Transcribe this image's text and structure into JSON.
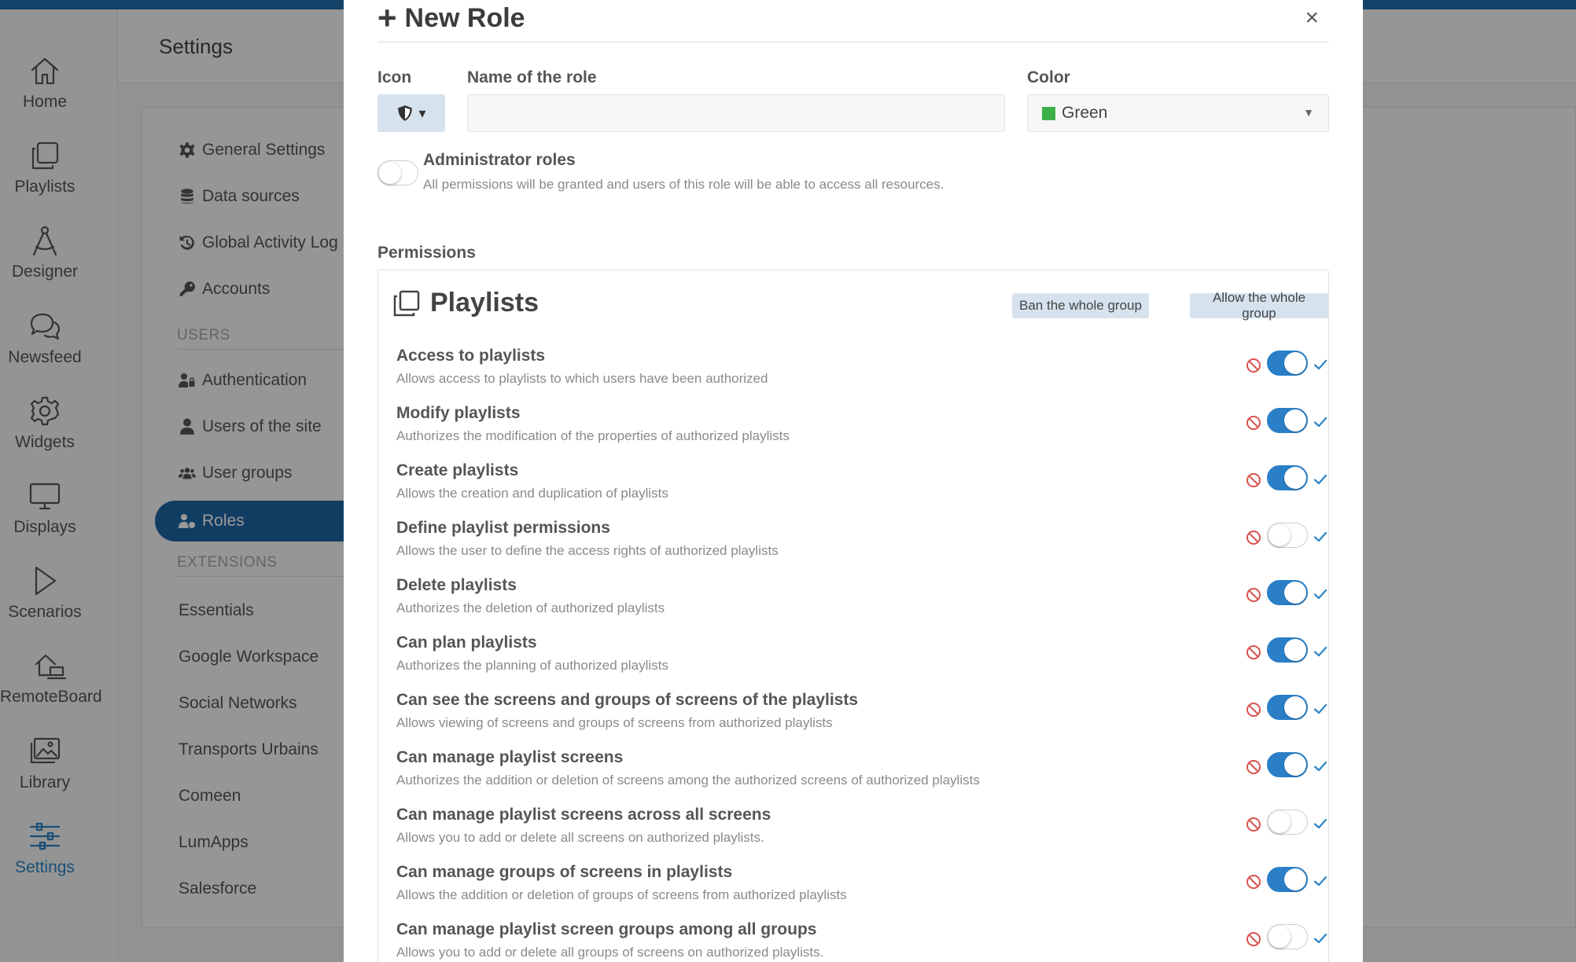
{
  "colors": {
    "primary": "#1f67a6",
    "toggle_on": "#2a7fc6",
    "ban": "#d9534f",
    "swatch_green": "#3db04a"
  },
  "rail": [
    {
      "label": "Home",
      "icon": "home-icon"
    },
    {
      "label": "Playlists",
      "icon": "playlists-icon"
    },
    {
      "label": "Designer",
      "icon": "designer-icon"
    },
    {
      "label": "Newsfeed",
      "icon": "newsfeed-icon"
    },
    {
      "label": "Widgets",
      "icon": "widgets-gear-icon"
    },
    {
      "label": "Displays",
      "icon": "displays-monitor-icon"
    },
    {
      "label": "Scenarios",
      "icon": "scenarios-play-icon"
    },
    {
      "label": "RemoteBoard",
      "icon": "remoteboard-icon"
    },
    {
      "label": "Library",
      "icon": "library-image-icon"
    },
    {
      "label": "Settings",
      "icon": "settings-sliders-icon",
      "active": true
    }
  ],
  "header": {
    "title": "Settings"
  },
  "settings_menu": {
    "items": [
      {
        "label": "General Settings",
        "icon": "gear-icon"
      },
      {
        "label": "Data sources",
        "icon": "database-icon"
      },
      {
        "label": "Global Activity Log",
        "icon": "history-icon"
      },
      {
        "label": "Accounts",
        "icon": "key-icon"
      }
    ],
    "users_section": "USERS",
    "user_items": [
      {
        "label": "Authentication",
        "icon": "user-lock-icon"
      },
      {
        "label": "Users of the site",
        "icon": "user-icon"
      },
      {
        "label": "User groups",
        "icon": "users-icon"
      },
      {
        "label": "Roles",
        "icon": "user-tag-icon",
        "active": true
      }
    ],
    "extensions_section": "EXTENSIONS",
    "extensions": [
      "Essentials",
      "Google Workspace",
      "Social Networks",
      "Transports Urbains",
      "Comeen",
      "LumApps",
      "Salesforce"
    ]
  },
  "modal": {
    "title": "New Role",
    "close": "×",
    "icon_label": "Icon",
    "name_label": "Name of the role",
    "name_value": "",
    "color_label": "Color",
    "color_value": "Green",
    "admin_title": "Administrator roles",
    "admin_desc": "All permissions will be granted and users of this role will be able to access all resources.",
    "admin_enabled": false,
    "permissions_label": "Permissions",
    "group": {
      "title": "Playlists",
      "ban_all": "Ban the whole group",
      "allow_all": "Allow the whole group",
      "permissions": [
        {
          "name": "Access to playlists",
          "desc": "Allows access to playlists to which users have been authorized",
          "enabled": true
        },
        {
          "name": "Modify playlists",
          "desc": "Authorizes the modification of the properties of authorized playlists",
          "enabled": true
        },
        {
          "name": "Create playlists",
          "desc": "Allows the creation and duplication of playlists",
          "enabled": true
        },
        {
          "name": "Define playlist permissions",
          "desc": "Allows the user to define the access rights of authorized playlists",
          "enabled": false
        },
        {
          "name": "Delete playlists",
          "desc": "Authorizes the deletion of authorized playlists",
          "enabled": true
        },
        {
          "name": "Can plan playlists",
          "desc": "Authorizes the planning of authorized playlists",
          "enabled": true
        },
        {
          "name": "Can see the screens and groups of screens of the playlists",
          "desc": "Allows viewing of screens and groups of screens from authorized playlists",
          "enabled": true
        },
        {
          "name": "Can manage playlist screens",
          "desc": "Authorizes the addition or deletion of screens among the authorized screens of authorized playlists",
          "enabled": true
        },
        {
          "name": "Can manage playlist screens across all screens",
          "desc": "Allows you to add or delete all screens on authorized playlists.",
          "enabled": false
        },
        {
          "name": "Can manage groups of screens in playlists",
          "desc": "Allows the addition or deletion of groups of screens from authorized playlists",
          "enabled": true
        },
        {
          "name": "Can manage playlist screen groups among all groups",
          "desc": "Allows you to add or delete all groups of screens on authorized playlists.",
          "enabled": false
        }
      ]
    }
  }
}
